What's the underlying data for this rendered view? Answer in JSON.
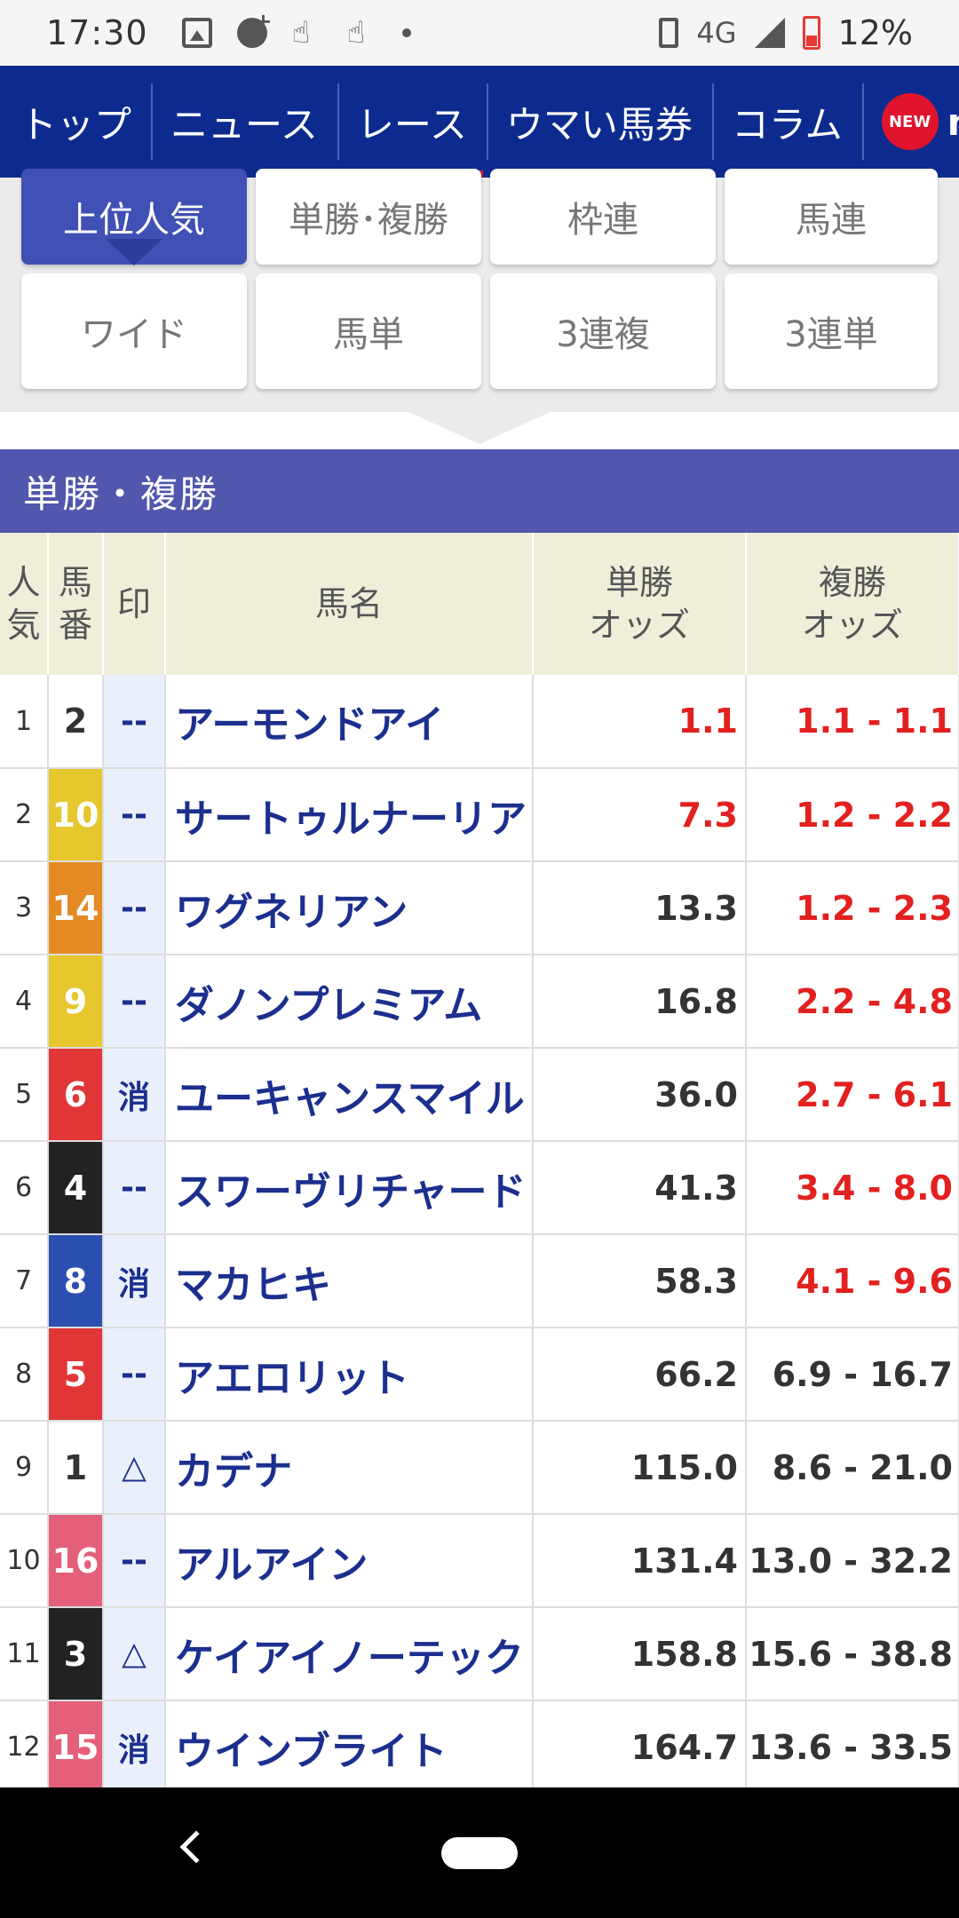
{
  "status_bar": {
    "time": "17:30",
    "network": "4G",
    "battery": "12%"
  },
  "nav": {
    "items": [
      "トップ",
      "ニュース",
      "レース",
      "ウマい馬券",
      "コラム"
    ],
    "active_index": 2,
    "new_badge": "NEW",
    "new_text": "ne"
  },
  "bet_tabs": {
    "row1": [
      "上位人気",
      "単勝･複勝",
      "枠連",
      "馬連"
    ],
    "row2": [
      "ワイド",
      "馬単",
      "3連複",
      "3連単"
    ],
    "active": "上位人気"
  },
  "section": {
    "title": "単勝・複勝"
  },
  "table": {
    "headers": {
      "popularity": [
        "人",
        "気"
      ],
      "number": [
        "馬",
        "番"
      ],
      "mark": "印",
      "name": "馬名",
      "win": [
        "単勝",
        "オッズ"
      ],
      "place": [
        "複勝",
        "オッズ"
      ]
    },
    "rows": [
      {
        "pop": "1",
        "num": "2",
        "mark": "--",
        "name": "アーモンドアイ",
        "win": "1.1",
        "place": "1.1 - 1.1",
        "color": "#ffffff",
        "text": "#333333",
        "win_red": true,
        "place_red": true
      },
      {
        "pop": "2",
        "num": "10",
        "mark": "--",
        "name": "サートゥルナーリア",
        "win": "7.3",
        "place": "1.2 - 2.2",
        "color": "#e6c72e",
        "text": "#ffffff",
        "win_red": true,
        "place_red": true
      },
      {
        "pop": "3",
        "num": "14",
        "mark": "--",
        "name": "ワグネリアン",
        "win": "13.3",
        "place": "1.2 - 2.3",
        "color": "#e58a22",
        "text": "#ffffff",
        "win_red": false,
        "place_red": true
      },
      {
        "pop": "4",
        "num": "9",
        "mark": "--",
        "name": "ダノンプレミアム",
        "win": "16.8",
        "place": "2.2 - 4.8",
        "color": "#e6c72e",
        "text": "#ffffff",
        "win_red": false,
        "place_red": true
      },
      {
        "pop": "5",
        "num": "6",
        "mark": "消",
        "name": "ユーキャンスマイル",
        "win": "36.0",
        "place": "2.7 - 6.1",
        "color": "#e03636",
        "text": "#ffffff",
        "win_red": false,
        "place_red": true
      },
      {
        "pop": "6",
        "num": "4",
        "mark": "--",
        "name": "スワーヴリチャード",
        "win": "41.3",
        "place": "3.4 - 8.0",
        "color": "#222222",
        "text": "#ffffff",
        "win_red": false,
        "place_red": true
      },
      {
        "pop": "7",
        "num": "8",
        "mark": "消",
        "name": "マカヒキ",
        "win": "58.3",
        "place": "4.1 - 9.6",
        "color": "#2b4fb0",
        "text": "#ffffff",
        "win_red": false,
        "place_red": true
      },
      {
        "pop": "8",
        "num": "5",
        "mark": "--",
        "name": "アエロリット",
        "win": "66.2",
        "place": "6.9 - 16.7",
        "color": "#e03636",
        "text": "#ffffff",
        "win_red": false,
        "place_red": false
      },
      {
        "pop": "9",
        "num": "1",
        "mark": "△",
        "name": "カデナ",
        "win": "115.0",
        "place": "8.6 - 21.0",
        "color": "#ffffff",
        "text": "#333333",
        "win_red": false,
        "place_red": false
      },
      {
        "pop": "10",
        "num": "16",
        "mark": "--",
        "name": "アルアイン",
        "win": "131.4",
        "place": "13.0 - 32.2",
        "color": "#e4607a",
        "text": "#ffffff",
        "win_red": false,
        "place_red": false
      },
      {
        "pop": "11",
        "num": "3",
        "mark": "△",
        "name": "ケイアイノーテック",
        "win": "158.8",
        "place": "15.6 - 38.8",
        "color": "#222222",
        "text": "#ffffff",
        "win_red": false,
        "place_red": false
      },
      {
        "pop": "12",
        "num": "15",
        "mark": "消",
        "name": "ウインブライト",
        "win": "164.7",
        "place": "13.6 - 33.5",
        "color": "#e4607a",
        "text": "#ffffff",
        "win_red": false,
        "place_red": false
      }
    ]
  }
}
